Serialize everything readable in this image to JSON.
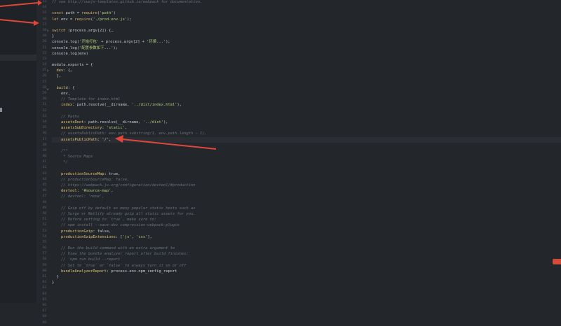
{
  "editor": {
    "line_numbers": [
      "13",
      "14",
      "15",
      "16",
      "17",
      "18",
      "19",
      "20",
      "21",
      "22",
      "23",
      "24",
      "25",
      "26",
      "27",
      "28",
      "29",
      "30",
      "31",
      "32",
      "33",
      "34",
      "35",
      "36",
      "37",
      "38",
      "39",
      "40",
      "41",
      "42",
      "43",
      "44",
      "45",
      "46",
      "47",
      "48",
      "49",
      "50",
      "51",
      "52",
      "53",
      "54",
      "55",
      "56",
      "57",
      "58",
      "59",
      "60",
      "61",
      "62",
      "63",
      "64",
      "65",
      "66",
      "67",
      "68",
      "69"
    ],
    "lines": [
      "// see http://vuejs-templates.github.io/webpack for documentation.",
      "",
      "const path = require('path')",
      "let env = require('./prod.env.js');",
      "",
      "switch (process.argv[2]) {…",
      "}",
      "console.log('开始打包' + process.argv[2] + '环境...');",
      "console.log('配置参数如下...');",
      "console.log(env)",
      "",
      "module.exports = {",
      "  dev: {…",
      "  },",
      "",
      "  build: {",
      "    env,",
      "    // Template for index.html",
      "    index: path.resolve(__dirname, '../dist/index.html'),",
      "",
      "    // Paths",
      "    assetsRoot: path.resolve(__dirname, '../dist'),",
      "    assetsSubDirectory: 'static',",
      "    // assetsPublicPath: env.path.substring(1, env.path.length - 1),",
      "    assetsPublicPath: '/',",
      "",
      "    /**",
      "     * Source Maps",
      "     */",
      "",
      "    productionSourceMap: true,",
      "    // productionSourceMap: false,",
      "    // https://webpack.js.org/configuration/devtool/#production",
      "    devtool: '#source-map',",
      "    // devtool: 'none',",
      "",
      "    // Gzip off by default as many popular static hosts such as",
      "    // Surge or Netlify already gzip all static assets for you.",
      "    // Before setting to `true`, make sure to:",
      "    // npm install --save-dev compression-webpack-plugin",
      "    productionGzip: false,",
      "    productionGzipExtensions: ['js', 'css'],",
      "",
      "    // Run the build command with an extra argument to",
      "    // View the bundle analyzer report after build finishes:",
      "    // `npm run build --report`",
      "    // Set to `true` or `false` to always turn it on or off",
      "    bundleAnalyzerReport: process.env.npm_config_report",
      "  }",
      "}",
      "",
      "",
      "",
      "",
      "",
      "",
      ""
    ]
  },
  "colors": {
    "annotation_arrow": "#e0473a",
    "background": "#23262b"
  },
  "icons": {
    "fold_markers": [
      "fold-collapsed-icon",
      "fold-expanded-icon"
    ]
  }
}
